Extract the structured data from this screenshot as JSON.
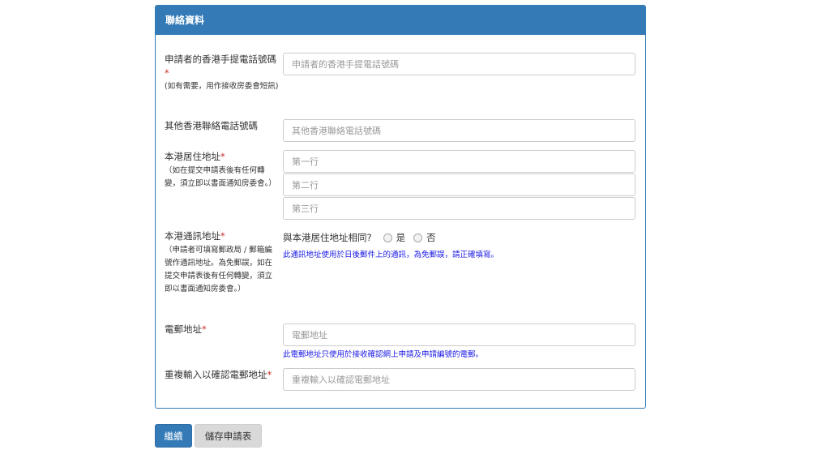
{
  "panel": {
    "title": "聯絡資料"
  },
  "mobile": {
    "label": "申請者的香港手提電話號碼",
    "required": "*",
    "note": "(如有需要，用作接收房委會短訊)",
    "placeholder": "申請者的香港手提電話號碼"
  },
  "other_phone": {
    "label": "其他香港聯絡電話號碼",
    "placeholder": "其他香港聯絡電話號碼"
  },
  "residential": {
    "label": "本港居住地址",
    "required": "*",
    "note": "（如在提交申請表後有任何轉變，須立即以書面通知房委會。）",
    "line1_placeholder": "第一行",
    "line2_placeholder": "第二行",
    "line3_placeholder": "第三行"
  },
  "correspondence": {
    "label": "本港通訊地址",
    "required": "*",
    "note": "（申請者可填寫郵政局 / 郵箱編號作通訊地址。為免郵誤，如在提交申請表後有任何轉變，須立即以書面通知房委會。）",
    "same_question": "與本港居住地址相同?",
    "option_yes": "是",
    "option_no": "否",
    "help": "此通訊地址使用於日後郵件上的通訊，為免郵誤，請正確填寫。"
  },
  "email": {
    "label": "電郵地址",
    "required": "*",
    "placeholder": "電郵地址",
    "help": "此電郵地址只使用於接收確認網上申請及申請編號的電郵。"
  },
  "email_confirm": {
    "label": "重複輸入以確認電郵地址",
    "required": "*",
    "placeholder": "重複輸入以確認電郵地址"
  },
  "buttons": {
    "continue": "繼續",
    "save": "儲存申請表"
  },
  "colors": {
    "primary": "#337ab7",
    "required": "#c9302c",
    "help_text": "#1a1ae6",
    "save_button": "#d9d9d9"
  }
}
